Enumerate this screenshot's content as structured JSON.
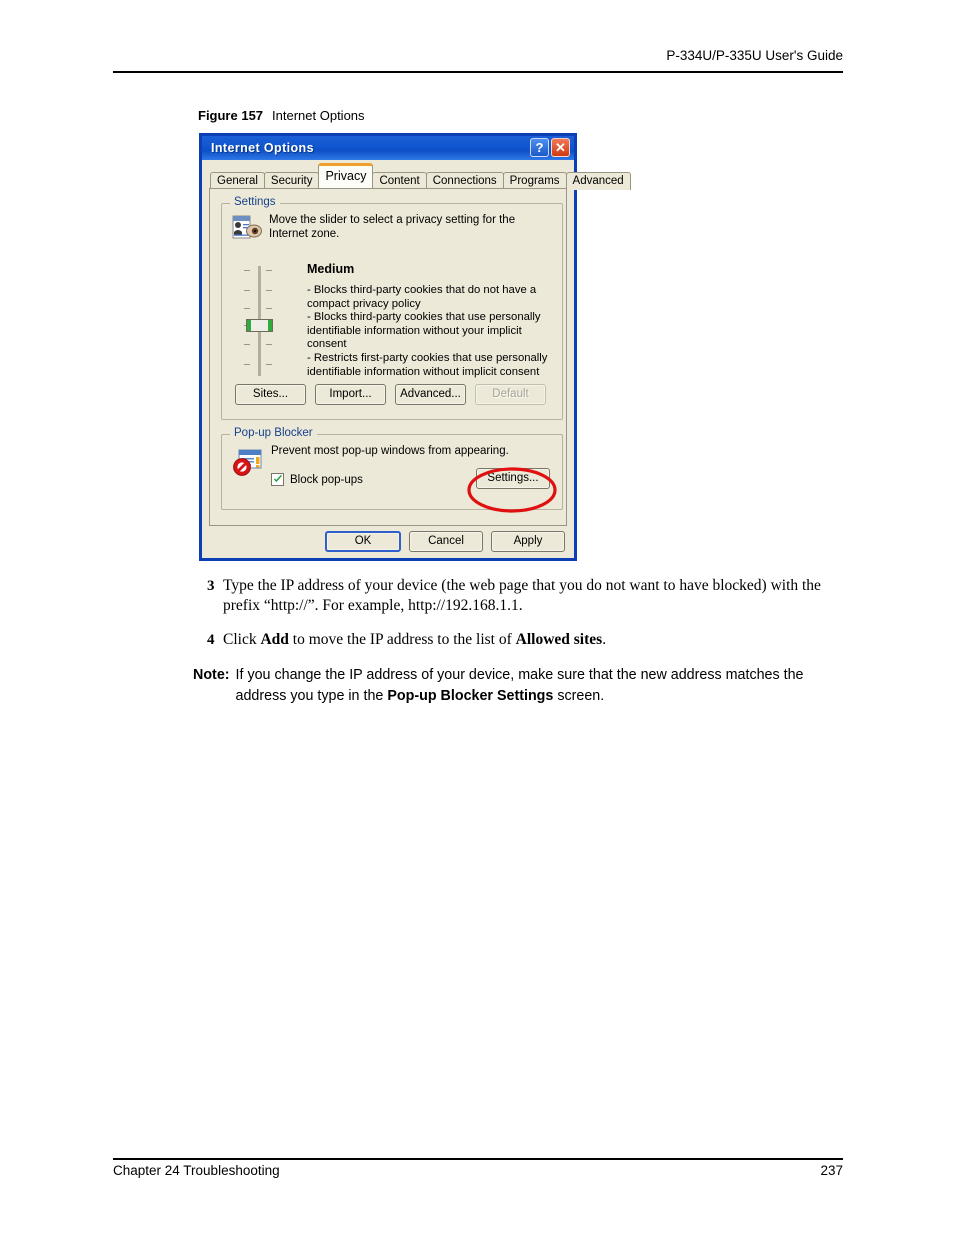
{
  "page": {
    "header_title": "P-334U/P-335U User's Guide",
    "footer_chapter": "Chapter 24 Troubleshooting",
    "footer_page_number": "237"
  },
  "figure": {
    "number_label": "Figure 157",
    "caption": "Internet Options"
  },
  "dialog": {
    "title": "Internet Options",
    "title_buttons": {
      "help": "?",
      "close": "✕"
    },
    "tabs": [
      {
        "label": "General",
        "active": false
      },
      {
        "label": "Security",
        "active": false
      },
      {
        "label": "Privacy",
        "active": true
      },
      {
        "label": "Content",
        "active": false
      },
      {
        "label": "Connections",
        "active": false
      },
      {
        "label": "Programs",
        "active": false
      },
      {
        "label": "Advanced",
        "active": false
      }
    ],
    "settings_group": {
      "title": "Settings",
      "description": "Move the slider to select a privacy setting for the Internet zone.",
      "level_name": "Medium",
      "level_description": "- Blocks third-party cookies that do not have a compact privacy policy\n- Blocks third-party cookies that use personally identifiable information without your implicit consent\n- Restricts first-party cookies that use personally identifiable information without implicit consent",
      "buttons": [
        {
          "label": "Sites...",
          "disabled": false
        },
        {
          "label": "Import...",
          "disabled": false
        },
        {
          "label": "Advanced...",
          "disabled": false
        },
        {
          "label": "Default",
          "disabled": true
        }
      ]
    },
    "popup_group": {
      "title": "Pop-up Blocker",
      "description": "Prevent most pop-up windows from appearing.",
      "checkbox_label": "Block pop-ups",
      "checkbox_checked": true,
      "settings_button": "Settings..."
    },
    "footer_buttons": [
      {
        "label": "OK",
        "default": true
      },
      {
        "label": "Cancel",
        "default": false
      },
      {
        "label": "Apply",
        "default": false
      }
    ]
  },
  "annotation": {
    "color": "#e01010",
    "target": "Settings..."
  },
  "steps": [
    {
      "number": "3",
      "text": "Type the IP address of your device (the web page that you do not want to have blocked) with the prefix “http://”. For example, http://192.168.1.1."
    },
    {
      "number": "4",
      "text_before": "Click ",
      "bold1": "Add",
      "text_mid": " to move the IP address to the list of ",
      "bold2": "Allowed sites",
      "text_after": "."
    }
  ],
  "note": {
    "label": "Note:",
    "text_before": "If you change the IP address of your device, make sure that the new address matches the address you type in the ",
    "bold": "Pop-up Blocker Settings",
    "text_after": " screen."
  }
}
